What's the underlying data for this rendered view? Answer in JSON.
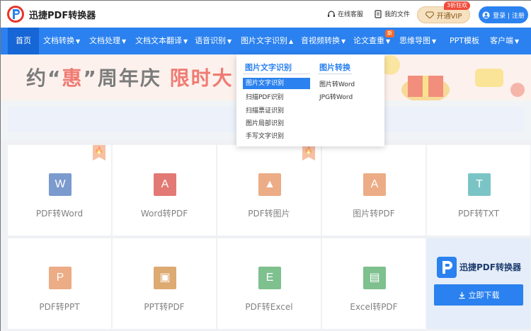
{
  "header": {
    "logo_text": "迅捷PDF转换器",
    "links": [
      {
        "label": "在线客服",
        "icon": "headset-icon"
      },
      {
        "label": "我的文件",
        "icon": "file-icon"
      }
    ],
    "vip_label": "开通VIP",
    "vip_badge": "3折狂欢",
    "login_label": "登录 | 注册"
  },
  "nav": {
    "items": [
      {
        "label": "首页",
        "has_caret": false
      },
      {
        "label": "文档转换",
        "has_caret": true
      },
      {
        "label": "文档处理",
        "has_caret": true
      },
      {
        "label": "文档文本翻译",
        "has_caret": true
      },
      {
        "label": "语音识别",
        "has_caret": true
      },
      {
        "label": "图片文字识别",
        "has_caret": true
      },
      {
        "label": "音视频转换",
        "has_caret": true
      },
      {
        "label": "论文查重",
        "has_caret": true
      },
      {
        "label": "思维导图",
        "has_caret": true
      },
      {
        "label": "PPT模板",
        "has_caret": false
      },
      {
        "label": "客户端",
        "has_caret": true
      }
    ],
    "new_badge": "新",
    "caret_down": "▼",
    "caret_up": "▲"
  },
  "banner": {
    "part1": "约“",
    "part2": "惠",
    "part3": "”周年庆  ",
    "part4": "限时大"
  },
  "dropdown": {
    "col1_title": "图片文字识别",
    "col1_items": [
      "图片文字识别",
      "扫描PDF识别",
      "扫描票证识别",
      "图片局部识别",
      "手写文字识别"
    ],
    "col2_title": "图片转换",
    "col2_items": [
      "图片转Word",
      "JPG转Word"
    ]
  },
  "tools": [
    {
      "label": "PDF转Word",
      "glyph": "W",
      "color": "#2b5db1",
      "hot": true
    },
    {
      "label": "Word转PDF",
      "glyph": "A",
      "color": "#d0281f",
      "hot": false
    },
    {
      "label": "PDF转图片",
      "glyph": "▲",
      "color": "#e0793d",
      "hot": true
    },
    {
      "label": "图片转PDF",
      "glyph": "A",
      "color": "#e0793d",
      "hot": false
    },
    {
      "label": "PDF转TXT",
      "glyph": "T",
      "color": "#2aa0a3",
      "hot": false
    },
    {
      "label": "PDF转PPT",
      "glyph": "P",
      "color": "#e0793d",
      "hot": false
    },
    {
      "label": "PPT转PDF",
      "glyph": "▣",
      "color": "#c9771c",
      "hot": false
    },
    {
      "label": "PDF转Excel",
      "glyph": "E",
      "color": "#2f9a4a",
      "hot": false
    },
    {
      "label": "Excel转PDF",
      "glyph": "▤",
      "color": "#2f9a4a",
      "hot": false
    }
  ],
  "download": {
    "title": "迅捷PDF转换器",
    "button": "立即下载"
  },
  "colors": {
    "primary": "#2a81ef",
    "nav_active": "#1666d6",
    "accent_red": "#e52a1e",
    "vip_gold": "#f6e1c0"
  }
}
